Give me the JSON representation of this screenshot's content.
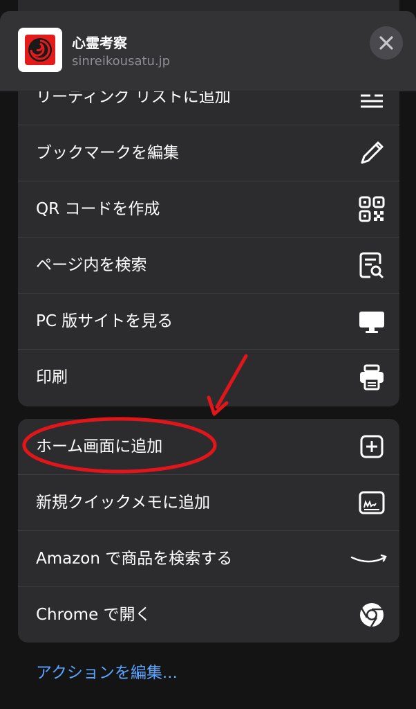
{
  "header": {
    "site_title": "心霊考察",
    "site_domain": "sinreikousatu.jp"
  },
  "group1": {
    "items": [
      {
        "label": "リーディング リストに追加",
        "icon": "reading-list-icon"
      },
      {
        "label": "ブックマークを編集",
        "icon": "pencil-icon"
      },
      {
        "label": "QR コードを作成",
        "icon": "qr-code-icon"
      },
      {
        "label": "ページ内を検索",
        "icon": "find-in-page-icon"
      },
      {
        "label": "PC 版サイトを見る",
        "icon": "desktop-icon"
      },
      {
        "label": "印刷",
        "icon": "printer-icon"
      }
    ]
  },
  "group2": {
    "items": [
      {
        "label": "ホーム画面に追加",
        "icon": "add-square-icon"
      },
      {
        "label": "新規クイックメモに追加",
        "icon": "quick-note-icon"
      },
      {
        "label": "Amazon で商品を検索する",
        "icon": "amazon-smile-icon"
      },
      {
        "label": "Chrome で開く",
        "icon": "chrome-icon"
      }
    ]
  },
  "footer": {
    "edit_actions": "アクションを編集..."
  },
  "colors": {
    "background": "#141414",
    "sheet": "#2c2c2e",
    "link": "#5aa3ff",
    "annotation": "#e0161b"
  }
}
